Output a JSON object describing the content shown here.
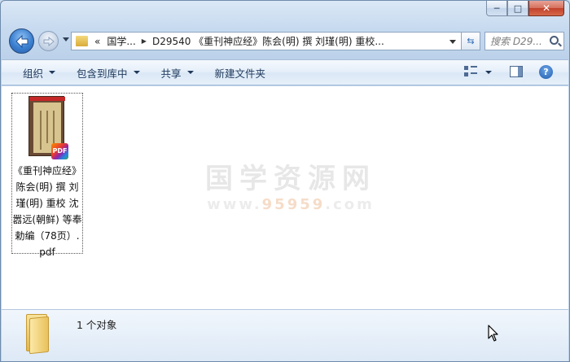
{
  "window": {
    "caption_buttons": {
      "minimize": "─",
      "maximize": "□",
      "close": "✕"
    }
  },
  "nav": {
    "back_icon": "back-arrow-icon",
    "forward_icon": "forward-arrow-icon"
  },
  "address": {
    "overflow": "«",
    "crumb1": "国学...",
    "crumb2": "D29540 《重刊神应经》陈会(明) 撰 刘瑾(明) 重校..."
  },
  "search": {
    "placeholder": "搜索 D29..."
  },
  "commands": {
    "organize": "组织",
    "include_library": "包含到库中",
    "share": "共享",
    "new_folder": "新建文件夹"
  },
  "file": {
    "name": "《重刊神应经》陈会(明) 撰 刘瑾(明) 重校 沈嚣远(朝鲜) 等奉勅编（78页）.pdf",
    "badge": "PDF"
  },
  "watermark": {
    "title": "国学资源网",
    "url_prefix": "www.",
    "url_number": "95959",
    "url_suffix": ".com"
  },
  "details": {
    "count": "1 个对象"
  },
  "colors": {
    "accent": "#1e395b",
    "window_frame": "#c7daef",
    "close": "#c2412a"
  }
}
